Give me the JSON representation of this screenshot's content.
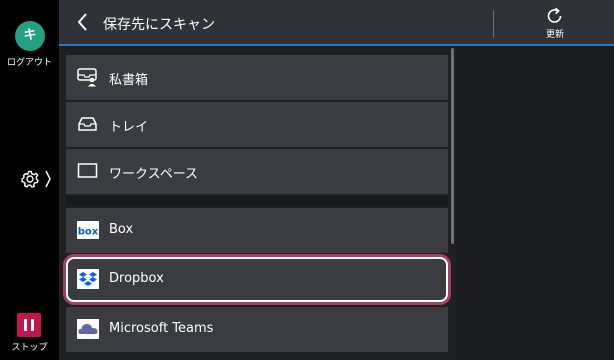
{
  "sidebar": {
    "avatar_letter": "キ",
    "logout_label": "ログアウト",
    "stop_label": "ストップ"
  },
  "header": {
    "title": "保存先にスキャン",
    "refresh_label": "更新"
  },
  "list": {
    "items": [
      {
        "label": "私書箱",
        "icon": "mailbox-user-icon"
      },
      {
        "label": "トレイ",
        "icon": "tray-icon"
      },
      {
        "label": "ワークスペース",
        "icon": "workspace-icon"
      },
      {
        "label": "Box",
        "icon": "box-logo-icon"
      },
      {
        "label": "Dropbox",
        "icon": "dropbox-logo-icon",
        "selected": true
      },
      {
        "label": "Microsoft Teams",
        "icon": "microsoft-teams-cloud-icon"
      }
    ]
  },
  "colors": {
    "accent_blue": "#2479c0",
    "selection_outline": "#a6405f",
    "avatar_green": "#21a282",
    "stop_red": "#c4144a"
  }
}
